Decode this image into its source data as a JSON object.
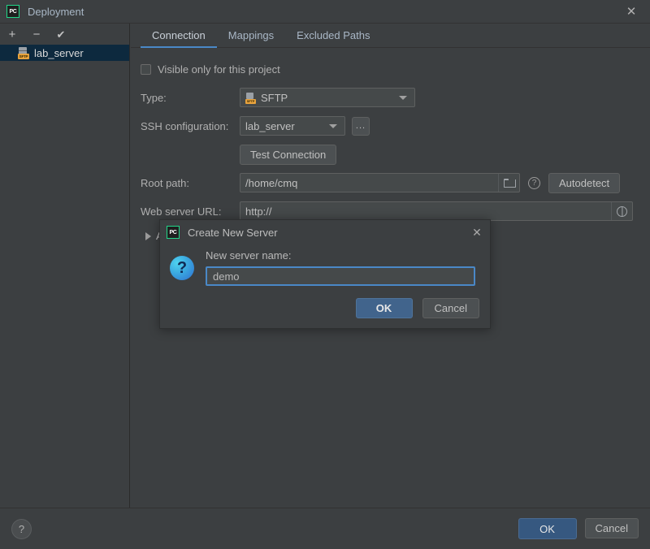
{
  "window": {
    "title": "Deployment",
    "logo_text": "PC",
    "close_icon": "close-icon"
  },
  "sidebar": {
    "toolbar": [
      {
        "name": "add",
        "glyph": "+"
      },
      {
        "name": "remove",
        "glyph": "−"
      },
      {
        "name": "set-default",
        "glyph": "✔"
      }
    ],
    "servers": [
      {
        "label": "lab_server",
        "badge": "SFTP",
        "selected": true
      }
    ]
  },
  "tabs": [
    {
      "label": "Connection",
      "active": true
    },
    {
      "label": "Mappings",
      "active": false
    },
    {
      "label": "Excluded Paths",
      "active": false
    }
  ],
  "connection": {
    "visible_only_label": "Visible only for this project",
    "visible_only_checked": false,
    "type_label": "Type:",
    "type_value": "SFTP",
    "type_badge": "SFTP",
    "ssh_label": "SSH configuration:",
    "ssh_value": "lab_server",
    "ssh_browse_label": "...",
    "test_connection_label": "Test Connection",
    "root_path_label": "Root path:",
    "root_path_value": "/home/cmq",
    "autodetect_label": "Autodetect",
    "web_url_label": "Web server URL:",
    "web_url_value": "http://",
    "advanced_label": "Advanced options"
  },
  "modal": {
    "title": "Create New Server",
    "logo_text": "PC",
    "icon": "question-icon",
    "field_label": "New server name:",
    "field_value": "demo",
    "ok_label": "OK",
    "cancel_label": "Cancel",
    "close_icon": "close-icon"
  },
  "footer": {
    "help_glyph": "?",
    "ok_label": "OK",
    "cancel_label": "Cancel"
  },
  "colors": {
    "background": "#3c3f41",
    "accent": "#4a88c7",
    "selection": "#0d293e",
    "primary_button": "#365880",
    "badge": "#e8a33d"
  }
}
